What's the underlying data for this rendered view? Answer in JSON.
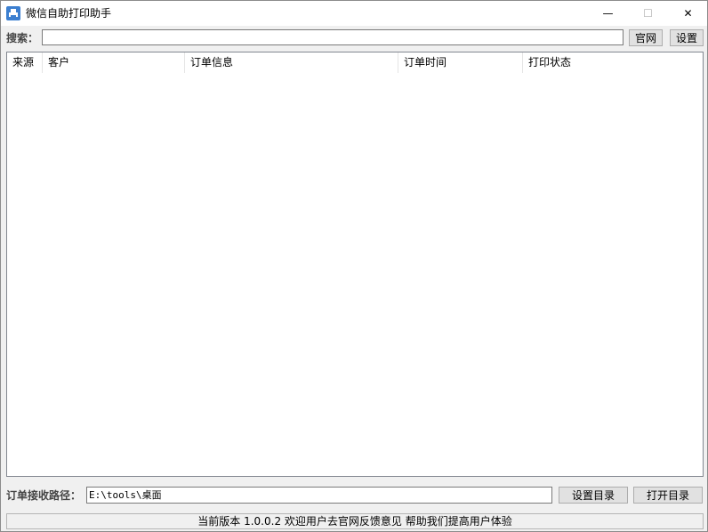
{
  "window": {
    "title": "微信自助打印助手",
    "minimize_glyph": "—",
    "maximize_glyph": "☐",
    "close_glyph": "✕"
  },
  "search": {
    "label": "搜索：",
    "value": "",
    "official_button": "官网",
    "settings_button": "设置"
  },
  "table": {
    "columns": [
      "来源",
      "客户",
      "订单信息",
      "订单时间",
      "打印状态"
    ],
    "rows": []
  },
  "path": {
    "label": "订单接收路径：",
    "value": "E:\\tools\\桌面",
    "set_dir_button": "设置目录",
    "open_dir_button": "打开目录"
  },
  "status": {
    "text": "当前版本 1.0.0.2 欢迎用户去官网反馈意见 帮助我们提高用户体验"
  },
  "colors": {
    "icon_blue": "#3c7fd0",
    "window_bg": "#f0f0f0"
  }
}
